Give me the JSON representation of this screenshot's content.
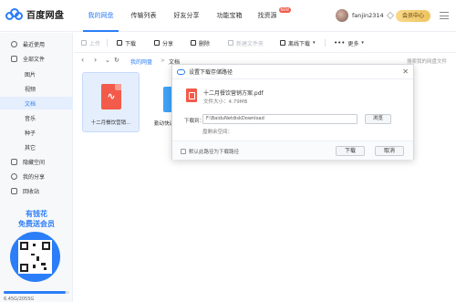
{
  "app": {
    "name": "百度网盘",
    "nav": [
      {
        "label": "我的网盘",
        "active": true
      },
      {
        "label": "传输列表"
      },
      {
        "label": "好友分享"
      },
      {
        "label": "功能宝箱"
      },
      {
        "label": "找资源",
        "badge": "NEW"
      }
    ],
    "username": "fanjin2314",
    "vip_label": "会员中心",
    "accent_color": "#2c7ef8"
  },
  "sidebar": {
    "items": [
      {
        "label": "最近使用",
        "icon": "clock-icon"
      },
      {
        "label": "全部文件",
        "icon": "file-icon"
      },
      {
        "label": "图片",
        "sub": true
      },
      {
        "label": "视频",
        "sub": true
      },
      {
        "label": "文档",
        "sub": true,
        "active": true
      },
      {
        "label": "音乐",
        "sub": true
      },
      {
        "label": "种子",
        "sub": true
      },
      {
        "label": "其它",
        "sub": true
      },
      {
        "label": "隐藏空间",
        "icon": "lock-icon"
      },
      {
        "label": "我的分享",
        "icon": "share-icon"
      },
      {
        "label": "回收站",
        "icon": "trash-icon"
      }
    ],
    "promo_line1": "有钱花",
    "promo_line2": "免费送会员",
    "storage_fill_fraction": 0.94,
    "storage_text": "6.45G/2055G"
  },
  "toolbar": {
    "items": [
      {
        "label": "上传",
        "icon": "upload-icon",
        "disabled": true
      },
      {
        "label": "下载",
        "icon": "download-icon"
      },
      {
        "label": "分享",
        "icon": "share-icon"
      },
      {
        "label": "删除",
        "icon": "delete-icon"
      },
      {
        "label": "新建文件夹",
        "icon": "new-folder-icon",
        "disabled": true
      },
      {
        "label": "离线下载",
        "icon": "offline-download-icon"
      },
      {
        "label": "更多",
        "icon": "more-icon"
      }
    ]
  },
  "path": {
    "crumbs": [
      "我的网盘",
      "文档"
    ],
    "search_tip": "搜索我的网盘文件"
  },
  "files": [
    {
      "name": "十二月餐饮营销...",
      "type": "pdf",
      "selected": true
    },
    {
      "name": "勤动快运...",
      "type": "folder"
    }
  ],
  "dialog": {
    "title": "设置下载存储路径",
    "file_name": "十二月餐饮营销方案.pdf",
    "file_size": "文件大小：4.79MB",
    "download_to_label": "下载到：",
    "path_value": "F:\\BaiduNetdiskDownload",
    "browse_label": "浏览",
    "space_label": "盘剩余空间：",
    "default_checkbox_label": "默认此路径为下载路径",
    "download_button": "下载",
    "cancel_button": "取消"
  }
}
